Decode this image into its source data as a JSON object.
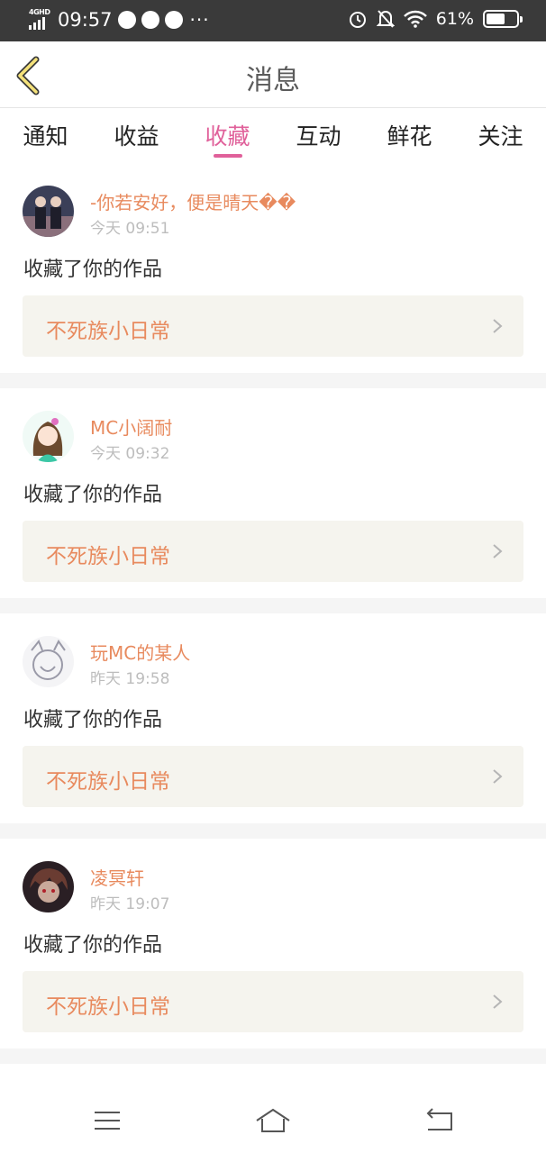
{
  "status_bar": {
    "network": "4GHD",
    "time": "09:57",
    "battery": "61%",
    "battery_level": 0.61,
    "icons": [
      "signal-icon",
      "speed-icon",
      "wechat-icon",
      "qq-icon",
      "alarm-icon",
      "mute-bell-icon",
      "wifi-icon",
      "battery-icon"
    ]
  },
  "header": {
    "title": "消息"
  },
  "tabs": [
    {
      "label": "通知"
    },
    {
      "label": "收益"
    },
    {
      "label": "收藏",
      "active": true
    },
    {
      "label": "互动"
    },
    {
      "label": "鲜花"
    },
    {
      "label": "关注"
    }
  ],
  "messages": [
    {
      "user": "-你若安好，便是晴天��",
      "time": "今天 09:51",
      "action": "收藏了你的作品",
      "work": "不死族小日常"
    },
    {
      "user": "MC小阔耐",
      "time": "今天 09:32",
      "action": "收藏了你的作品",
      "work": "不死族小日常"
    },
    {
      "user": "玩MC的某人",
      "time": "昨天 19:58",
      "action": "收藏了你的作品",
      "work": "不死族小日常"
    },
    {
      "user": "凌冥轩",
      "time": "昨天 19:07",
      "action": "收藏了你的作品",
      "work": "不死族小日常"
    }
  ],
  "colors": {
    "accent": "#e0609a",
    "username": "#e88a5e",
    "work_bg": "#f5f4ee",
    "status_bar": "#3a3a3a"
  }
}
